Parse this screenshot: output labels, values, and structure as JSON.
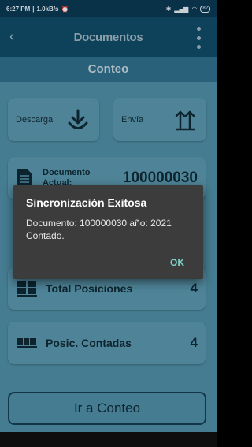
{
  "status_bar": {
    "time": "6:27 PM",
    "speed": "1.0kB/s",
    "battery": "82"
  },
  "appbar": {
    "title": "Documentos",
    "section": "Conteo"
  },
  "actions": {
    "descarga_label": "Descarga",
    "envia_label": "Envía"
  },
  "documento": {
    "label": "Documento Actual:",
    "value": "100000030"
  },
  "total_posiciones": {
    "label": "Total Posiciones",
    "value": "4"
  },
  "posic_contadas": {
    "label": "Posic. Contadas",
    "value": "4"
  },
  "primary_button": {
    "label": "Ir a Conteo"
  },
  "dialog": {
    "title": "Sincronización Exitosa",
    "message": "Documento: 100000030 año: 2021 Contado.",
    "ok_label": "OK"
  },
  "colors": {
    "appbar": "#104a67",
    "background": "#4f8ea6",
    "dialog": "#3c3c3c",
    "dialog_button": "#7fd3c8"
  }
}
